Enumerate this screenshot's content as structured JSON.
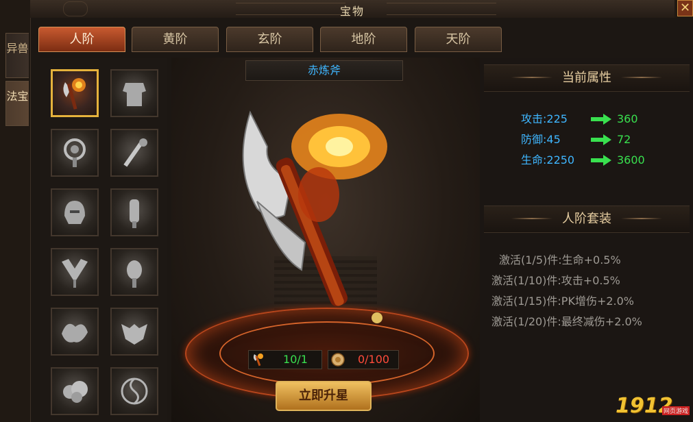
{
  "window": {
    "title": "宝物",
    "close_label": "✕"
  },
  "side_tabs": [
    {
      "label": "异兽",
      "active": false
    },
    {
      "label": "法宝",
      "active": true
    }
  ],
  "tier_tabs": [
    {
      "label": "人阶",
      "active": true
    },
    {
      "label": "黄阶",
      "active": false
    },
    {
      "label": "玄阶",
      "active": false
    },
    {
      "label": "地阶",
      "active": false
    },
    {
      "label": "天阶",
      "active": false
    }
  ],
  "treasure_grid": {
    "selected_index": 0,
    "count": 12
  },
  "item": {
    "name": "赤炼斧"
  },
  "costs": {
    "material": "10/1",
    "material_color": "#39e04f",
    "coin": "0/100",
    "coin_color": "#ff4b3a"
  },
  "upgrade_button": "立即升星",
  "current_attributes": {
    "title": "当前属性",
    "rows": [
      {
        "label": "攻击:225",
        "next": "360"
      },
      {
        "label": "防御:45",
        "next": "72"
      },
      {
        "label": "生命:2250",
        "next": "3600"
      }
    ]
  },
  "set_bonus": {
    "title": "人阶套装",
    "lines": [
      "激活(1/5)件:生命+0.5%",
      "激活(1/10)件:攻击+0.5%",
      "激活(1/15)件:PK增伤+2.0%",
      "激活(1/20)件:最终减伤+2.0%"
    ]
  },
  "watermark": {
    "text": "1912",
    "badge": "网页游戏"
  },
  "colors": {
    "accent_blue": "#3fb6ff",
    "accent_green": "#39e04f",
    "accent_red": "#ff4b3a",
    "gold": "#e6b23c"
  }
}
